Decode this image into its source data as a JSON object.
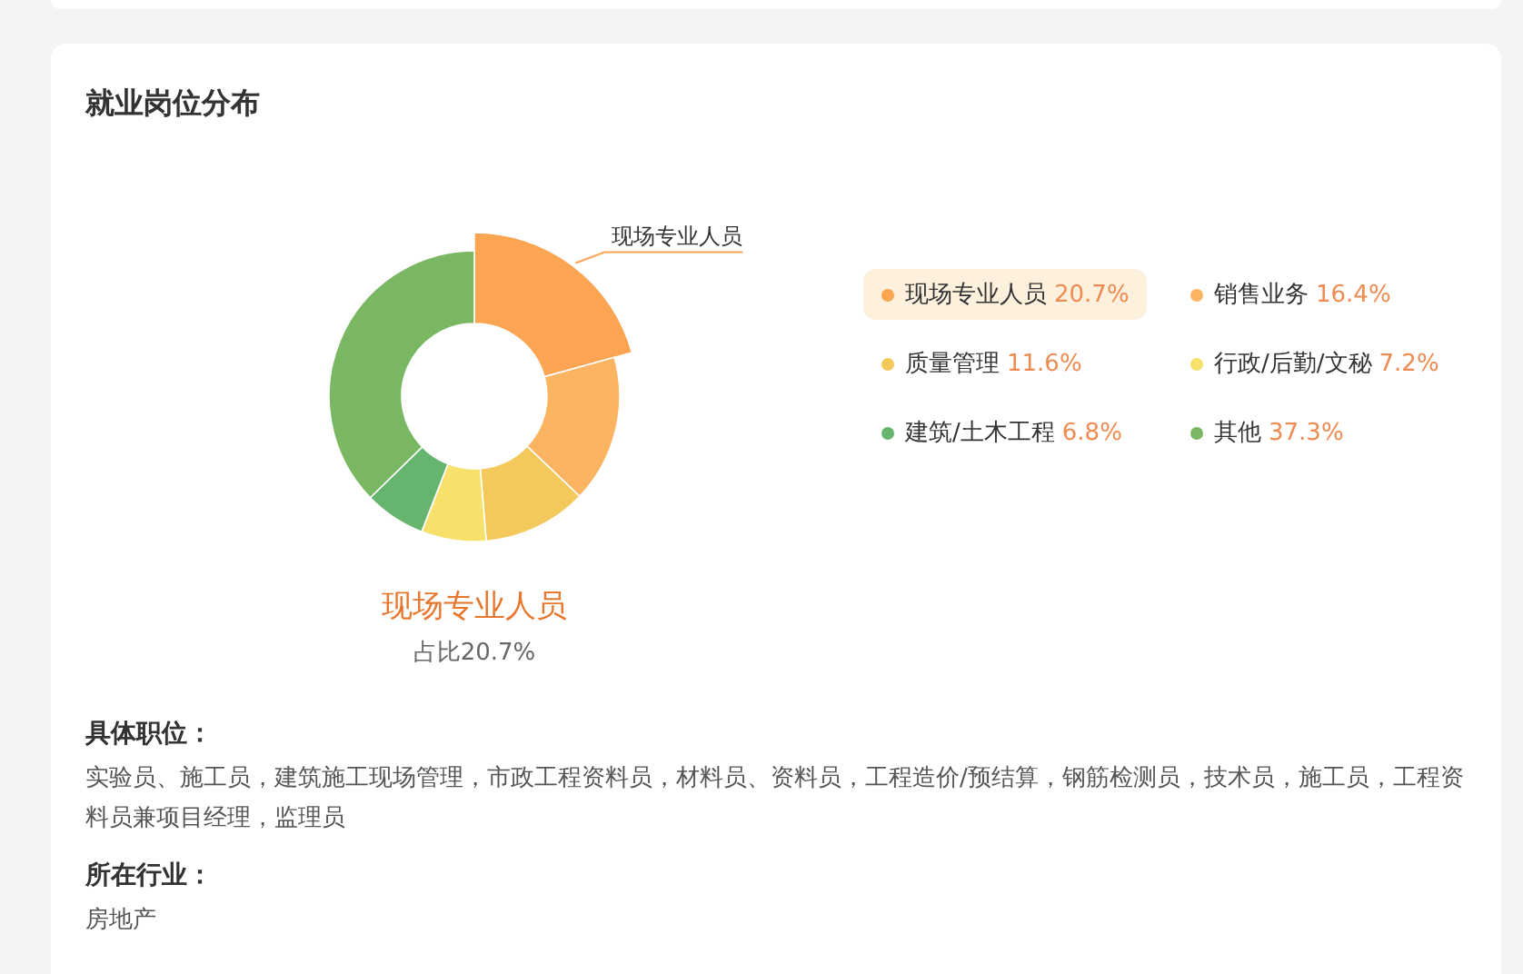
{
  "section": {
    "title": "就业岗位分布"
  },
  "chart": {
    "chart_data": {
      "type": "donut",
      "categories": [
        "现场专业人员",
        "销售业务",
        "质量管理",
        "行政/后勤/文秘",
        "建筑/土木工程",
        "其他"
      ],
      "values": [
        20.7,
        16.4,
        11.6,
        7.2,
        6.8,
        37.3
      ]
    },
    "callout": "现场专业人员",
    "selected_name": "现场专业人员",
    "selected_share": "占比20.7%"
  },
  "legend": [
    {
      "value": "20.7%",
      "color": "#fba553",
      "selected": true
    },
    {
      "value": "16.4%",
      "color": "#fbb462",
      "selected": false
    },
    {
      "value": "11.6%",
      "color": "#f4c95c",
      "selected": false
    },
    {
      "value": "7.2%",
      "color": "#f7e06c",
      "selected": false
    },
    {
      "value": "6.8%",
      "color": "#66b56f",
      "selected": false
    },
    {
      "value": "37.3%",
      "color": "#7ab763",
      "selected": false
    }
  ],
  "details": [
    {
      "heading": "具体职位：",
      "text": "实验员、施工员，建筑施工现场管理，市政工程资料员，材料员、资料员，工程造价/预结算，钢筋检测员，技术员，施工员，工程资料员兼项目经理，监理员"
    },
    {
      "heading": "所在行业：",
      "text": "房地产"
    }
  ]
}
